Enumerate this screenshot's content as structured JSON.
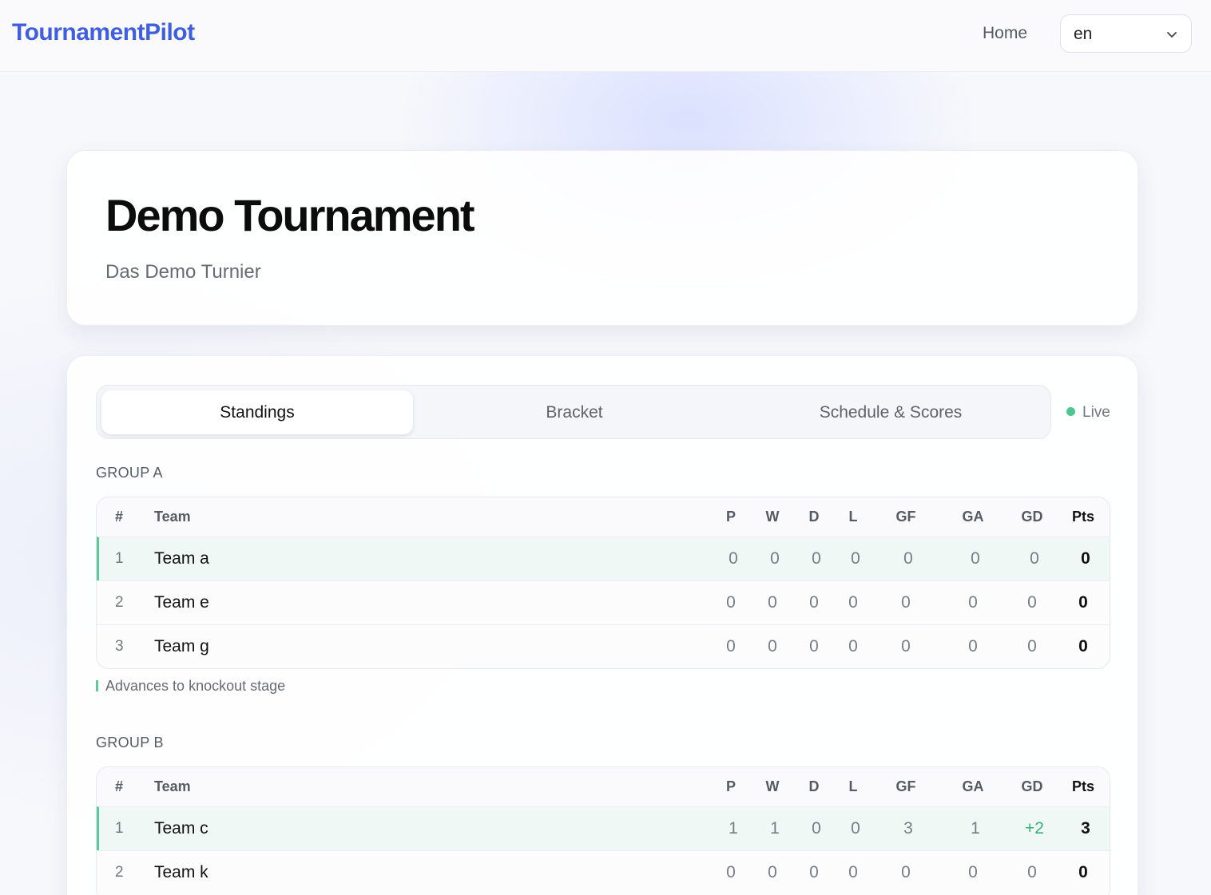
{
  "app": {
    "logo": "TournamentPilot"
  },
  "nav": {
    "home": "Home",
    "language": "en"
  },
  "tournament": {
    "title": "Demo Tournament",
    "subtitle": "Das Demo Turnier"
  },
  "tabs": [
    {
      "label": "Standings",
      "active": true
    },
    {
      "label": "Bracket",
      "active": false
    },
    {
      "label": "Schedule & Scores",
      "active": false
    }
  ],
  "live": "Live",
  "columns": {
    "rank": "#",
    "team": "Team",
    "p": "P",
    "w": "W",
    "d": "D",
    "l": "L",
    "gf": "GF",
    "ga": "GA",
    "gd": "GD",
    "pts": "Pts"
  },
  "groups": [
    {
      "name": "GROUP A",
      "rows": [
        {
          "rank": "1",
          "team": "Team a",
          "p": "0",
          "w": "0",
          "d": "0",
          "l": "0",
          "gf": "0",
          "ga": "0",
          "gd": "0",
          "pts": "0",
          "qualified": true
        },
        {
          "rank": "2",
          "team": "Team e",
          "p": "0",
          "w": "0",
          "d": "0",
          "l": "0",
          "gf": "0",
          "ga": "0",
          "gd": "0",
          "pts": "0",
          "qualified": false
        },
        {
          "rank": "3",
          "team": "Team g",
          "p": "0",
          "w": "0",
          "d": "0",
          "l": "0",
          "gf": "0",
          "ga": "0",
          "gd": "0",
          "pts": "0",
          "qualified": false
        }
      ]
    },
    {
      "name": "GROUP B",
      "rows": [
        {
          "rank": "1",
          "team": "Team c",
          "p": "1",
          "w": "1",
          "d": "0",
          "l": "0",
          "gf": "3",
          "ga": "1",
          "gd": "+2",
          "pts": "3",
          "qualified": true
        },
        {
          "rank": "2",
          "team": "Team k",
          "p": "0",
          "w": "0",
          "d": "0",
          "l": "0",
          "gf": "0",
          "ga": "0",
          "gd": "0",
          "pts": "0",
          "qualified": false
        }
      ]
    }
  ],
  "legend": "Advances to knockout stage",
  "colors": {
    "brand": "#3f5fe0",
    "live": "#4cc792",
    "qualified": "#5ccb9b",
    "positive": "#3bb07a"
  }
}
